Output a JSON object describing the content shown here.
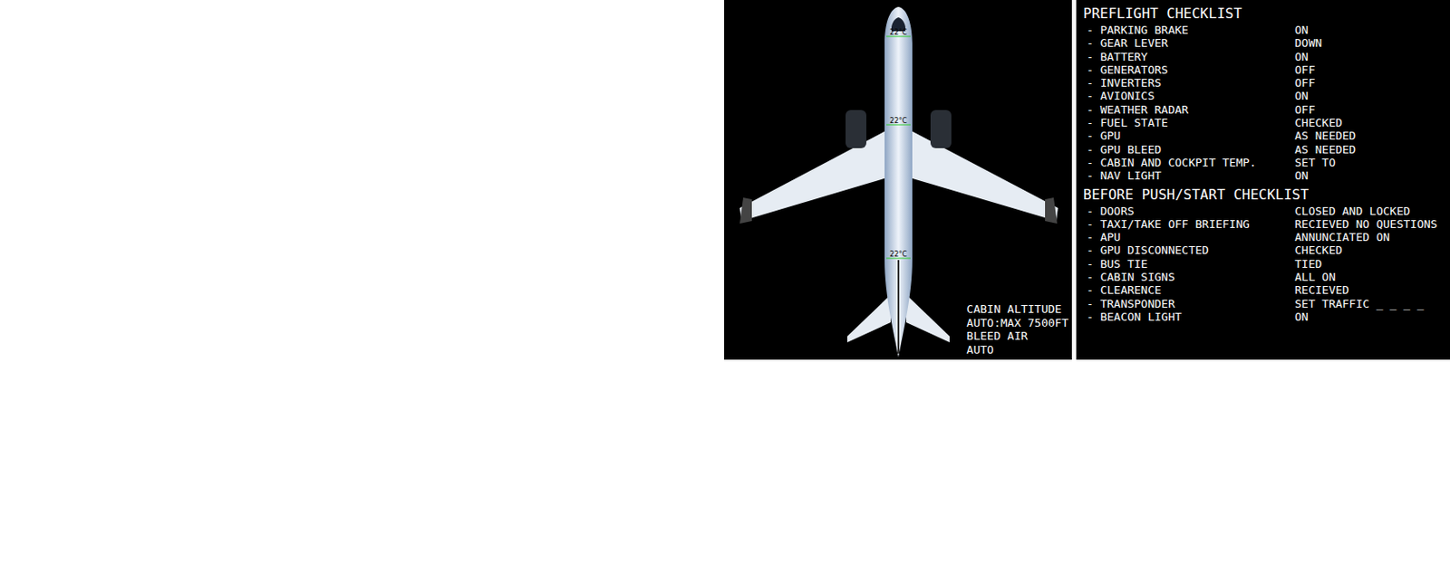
{
  "aircraft": {
    "zones": [
      {
        "temp": "22°C"
      },
      {
        "temp": "22°C"
      },
      {
        "temp": "22°C"
      }
    ],
    "info": [
      "CABIN ALTITUDE",
      "AUTO:MAX 7500FT",
      "BLEED AIR",
      "AUTO"
    ]
  },
  "checklists": [
    {
      "title": "PREFLIGHT CHECKLIST",
      "items": [
        {
          "label": "- PARKING BRAKE",
          "value": "ON"
        },
        {
          "label": "- GEAR LEVER",
          "value": "DOWN"
        },
        {
          "label": "- BATTERY",
          "value": "ON"
        },
        {
          "label": "- GENERATORS",
          "value": "OFF"
        },
        {
          "label": "- INVERTERS",
          "value": "OFF"
        },
        {
          "label": "- AVIONICS",
          "value": "ON"
        },
        {
          "label": "- WEATHER RADAR",
          "value": "OFF"
        },
        {
          "label": "- FUEL STATE",
          "value": "CHECKED"
        },
        {
          "label": "- GPU",
          "value": "AS NEEDED"
        },
        {
          "label": "- GPU BLEED",
          "value": "AS NEEDED"
        },
        {
          "label": "- CABIN AND COCKPIT TEMP.",
          "value": "SET TO"
        },
        {
          "label": "- NAV LIGHT",
          "value": "ON"
        }
      ]
    },
    {
      "title": "BEFORE PUSH/START CHECKLIST",
      "items": [
        {
          "label": "- DOORS",
          "value": "CLOSED AND LOCKED"
        },
        {
          "label": "- TAXI/TAKE OFF BRIEFING",
          "value": "RECIEVED NO QUESTIONS"
        },
        {
          "label": "- APU",
          "value": "ANNUNCIATED ON"
        },
        {
          "label": "- GPU DISCONNECTED",
          "value": "CHECKED"
        },
        {
          "label": "- BUS TIE",
          "value": "TIED"
        },
        {
          "label": "- CABIN SIGNS",
          "value": "ALL ON"
        },
        {
          "label": "- CLEARENCE",
          "value": "RECIEVED"
        },
        {
          "label": "- TRANSPONDER",
          "value": "SET TRAFFIC _ _ _ _"
        },
        {
          "label": "- BEACON LIGHT",
          "value": "ON"
        }
      ]
    }
  ]
}
